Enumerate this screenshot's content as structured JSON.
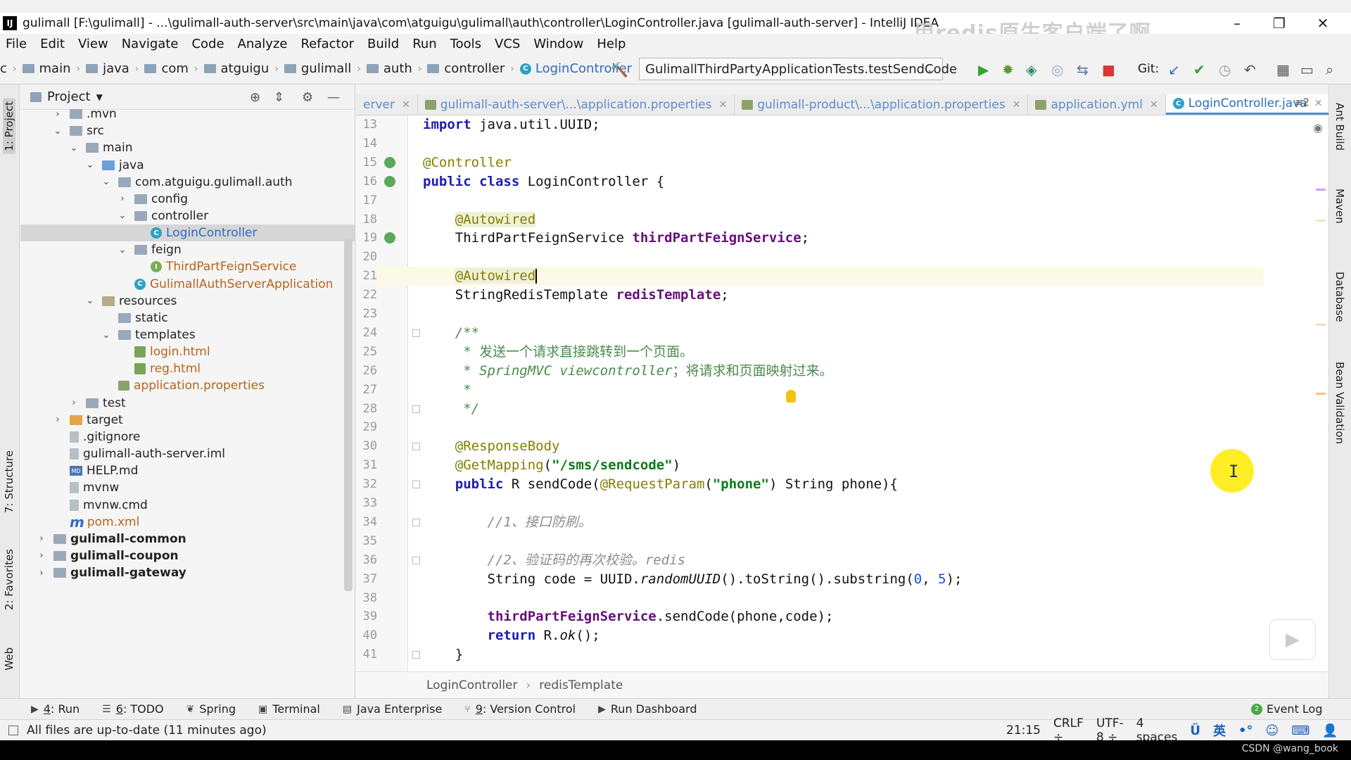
{
  "window": {
    "title": "gulimall [F:\\gulimall] - ...\\gulimall-auth-server\\src\\main\\java\\com\\atguigu\\gulimall\\auth\\controller\\LoginController.java [gulimall-auth-server] - IntelliJ IDEA",
    "app_icon": "IJ",
    "overlay_caption": "用redis原生客户端了啊"
  },
  "menu": [
    "File",
    "Edit",
    "View",
    "Navigate",
    "Code",
    "Analyze",
    "Refactor",
    "Build",
    "Run",
    "Tools",
    "VCS",
    "Window",
    "Help"
  ],
  "navbar": {
    "lead": "c",
    "crumbs": [
      "main",
      "java",
      "com",
      "atguigu",
      "gulimall",
      "auth",
      "controller"
    ],
    "current_class": "LoginController",
    "run_config": "GulimallThirdPartyApplicationTests.testSendCode",
    "git_label": "Git:"
  },
  "left_strip": {
    "project": "1: Project",
    "structure": "7: Structure",
    "favorites": "2: Favorites",
    "web": "Web"
  },
  "right_strip": {
    "ant": "Ant Build",
    "maven": "Maven",
    "database": "Database",
    "bean": "Bean Validation"
  },
  "project_panel": {
    "title": "Project",
    "tree": [
      {
        "label": ".mvn",
        "depth": 2,
        "arrow": "right",
        "icon": "folder"
      },
      {
        "label": "src",
        "depth": 2,
        "arrow": "down",
        "icon": "folder"
      },
      {
        "label": "main",
        "depth": 3,
        "arrow": "down",
        "icon": "folder"
      },
      {
        "label": "java",
        "depth": 4,
        "arrow": "down",
        "icon": "src"
      },
      {
        "label": "com.atguigu.gulimall.auth",
        "depth": 5,
        "arrow": "down",
        "icon": "folder"
      },
      {
        "label": "config",
        "depth": 6,
        "arrow": "right",
        "icon": "folder"
      },
      {
        "label": "controller",
        "depth": 6,
        "arrow": "down",
        "icon": "folder"
      },
      {
        "label": "LoginController",
        "depth": 7,
        "arrow": "",
        "icon": "class",
        "style": "blue",
        "selected": true
      },
      {
        "label": "feign",
        "depth": 6,
        "arrow": "down",
        "icon": "folder"
      },
      {
        "label": "ThirdPartFeignService",
        "depth": 7,
        "arrow": "",
        "icon": "interface",
        "style": "orange"
      },
      {
        "label": "GulimallAuthServerApplication",
        "depth": 6,
        "arrow": "",
        "icon": "class",
        "style": "orange"
      },
      {
        "label": "resources",
        "depth": 4,
        "arrow": "down",
        "icon": "res"
      },
      {
        "label": "static",
        "depth": 5,
        "arrow": "",
        "icon": "folder"
      },
      {
        "label": "templates",
        "depth": 5,
        "arrow": "down",
        "icon": "folder"
      },
      {
        "label": "login.html",
        "depth": 6,
        "arrow": "",
        "icon": "html",
        "style": "orange"
      },
      {
        "label": "reg.html",
        "depth": 6,
        "arrow": "",
        "icon": "html",
        "style": "orange"
      },
      {
        "label": "application.properties",
        "depth": 5,
        "arrow": "",
        "icon": "props",
        "style": "orange"
      },
      {
        "label": "test",
        "depth": 3,
        "arrow": "right",
        "icon": "folder"
      },
      {
        "label": "target",
        "depth": 2,
        "arrow": "right",
        "icon": "target"
      },
      {
        "label": ".gitignore",
        "depth": 2,
        "arrow": "",
        "icon": "file"
      },
      {
        "label": "gulimall-auth-server.iml",
        "depth": 2,
        "arrow": "",
        "icon": "file"
      },
      {
        "label": "HELP.md",
        "depth": 2,
        "arrow": "",
        "icon": "md"
      },
      {
        "label": "mvnw",
        "depth": 2,
        "arrow": "",
        "icon": "file"
      },
      {
        "label": "mvnw.cmd",
        "depth": 2,
        "arrow": "",
        "icon": "file"
      },
      {
        "label": "pom.xml",
        "depth": 2,
        "arrow": "",
        "icon": "maven",
        "style": "orange"
      },
      {
        "label": "gulimall-common",
        "depth": 1,
        "arrow": "right",
        "icon": "folder",
        "style": "bold"
      },
      {
        "label": "gulimall-coupon",
        "depth": 1,
        "arrow": "right",
        "icon": "folder",
        "style": "bold"
      },
      {
        "label": "gulimall-gateway",
        "depth": 1,
        "arrow": "right",
        "icon": "folder",
        "style": "bold"
      }
    ]
  },
  "editor_tabs": [
    {
      "label": "erver",
      "kind": "partial"
    },
    {
      "label": "gulimall-auth-server\\...\\application.properties",
      "kind": "props"
    },
    {
      "label": "gulimall-product\\...\\application.properties",
      "kind": "props"
    },
    {
      "label": "application.yml",
      "kind": "props"
    },
    {
      "label": "LoginController.java",
      "kind": "class",
      "active": true
    }
  ],
  "tabs_overflow": "≡2",
  "code": {
    "first_line": 13,
    "lines": [
      [
        {
          "t": "import",
          "c": "kw"
        },
        {
          "t": " java.util.UUID;"
        }
      ],
      [],
      [
        {
          "t": "@Controller",
          "c": "ann"
        }
      ],
      [
        {
          "t": "public class",
          "c": "kw"
        },
        {
          "t": " LoginController {"
        }
      ],
      [],
      [
        {
          "t": "    "
        },
        {
          "t": "@Autowired",
          "c": "ann-hl"
        }
      ],
      [
        {
          "t": "    ThirdPartFeignService "
        },
        {
          "t": "thirdPartFeignService",
          "c": "fld"
        },
        {
          "t": ";"
        }
      ],
      [],
      [
        {
          "t": "    "
        },
        {
          "t": "@Autowired",
          "c": "ann-hl"
        },
        {
          "t": "",
          "c": "cursor"
        }
      ],
      [
        {
          "t": "    StringRedisTemplate "
        },
        {
          "t": "redisTemplate",
          "c": "fld"
        },
        {
          "t": ";"
        }
      ],
      [],
      [
        {
          "t": "    /**",
          "c": "doc"
        }
      ],
      [
        {
          "t": "     * ",
          "c": "doc"
        },
        {
          "t": "发送一个请求直接跳转到一个页面。",
          "c": "doc-cn"
        }
      ],
      [
        {
          "t": "     * SpringMVC viewcontroller",
          "c": "doc"
        },
        {
          "t": "；将请求和页面映射过来。",
          "c": "doc-cn"
        }
      ],
      [
        {
          "t": "     *",
          "c": "doc"
        }
      ],
      [
        {
          "t": "     */",
          "c": "doc"
        }
      ],
      [],
      [
        {
          "t": "    "
        },
        {
          "t": "@ResponseBody",
          "c": "ann"
        }
      ],
      [
        {
          "t": "    "
        },
        {
          "t": "@GetMapping",
          "c": "ann"
        },
        {
          "t": "("
        },
        {
          "t": "\"/sms/sendcode\"",
          "c": "str"
        },
        {
          "t": ")"
        }
      ],
      [
        {
          "t": "    "
        },
        {
          "t": "public",
          "c": "kw"
        },
        {
          "t": " R sendCode("
        },
        {
          "t": "@RequestParam",
          "c": "ann"
        },
        {
          "t": "("
        },
        {
          "t": "\"phone\"",
          "c": "str"
        },
        {
          "t": ") String phone){"
        }
      ],
      [],
      [
        {
          "t": "        //1、接口防刷。",
          "c": "cmt"
        }
      ],
      [],
      [
        {
          "t": "        //2、验证码的再次校验。redis",
          "c": "cmt"
        }
      ],
      [
        {
          "t": "        String code = UUID."
        },
        {
          "t": "randomUUID",
          "c": "ital"
        },
        {
          "t": "().toString().substring("
        },
        {
          "t": "0",
          "c": "num"
        },
        {
          "t": ", "
        },
        {
          "t": "5",
          "c": "num"
        },
        {
          "t": ");"
        }
      ],
      [],
      [
        {
          "t": "        "
        },
        {
          "t": "thirdPartFeignService",
          "c": "fld"
        },
        {
          "t": ".sendCode(phone,code);"
        }
      ],
      [
        {
          "t": "        "
        },
        {
          "t": "return",
          "c": "kw"
        },
        {
          "t": " R."
        },
        {
          "t": "ok",
          "c": "ital"
        },
        {
          "t": "();"
        }
      ],
      [
        {
          "t": "    }"
        }
      ]
    ]
  },
  "editor_breadcrumb": [
    "LoginController",
    "redisTemplate"
  ],
  "bottom_tools": [
    {
      "num": "4",
      "label": ": Run",
      "icon": "▶"
    },
    {
      "num": "6",
      "label": ": TODO",
      "icon": "☰"
    },
    {
      "num": "",
      "label": "Spring",
      "icon": "❦"
    },
    {
      "num": "",
      "label": "Terminal",
      "icon": "▣"
    },
    {
      "num": "",
      "label": "Java Enterprise",
      "icon": "▤"
    },
    {
      "num": "9",
      "label": ": Version Control",
      "icon": "⑂"
    },
    {
      "num": "",
      "label": "Run Dashboard",
      "icon": "▶"
    }
  ],
  "event_log": "Event Log",
  "status": {
    "message": "All files are up-to-date (11 minutes ago)",
    "position": "21:15",
    "line_sep": "CRLF ÷",
    "encoding": "UTF-8 ÷",
    "indent": "4 spaces",
    "ime": "英"
  },
  "watermark": "CSDN @wang_book"
}
